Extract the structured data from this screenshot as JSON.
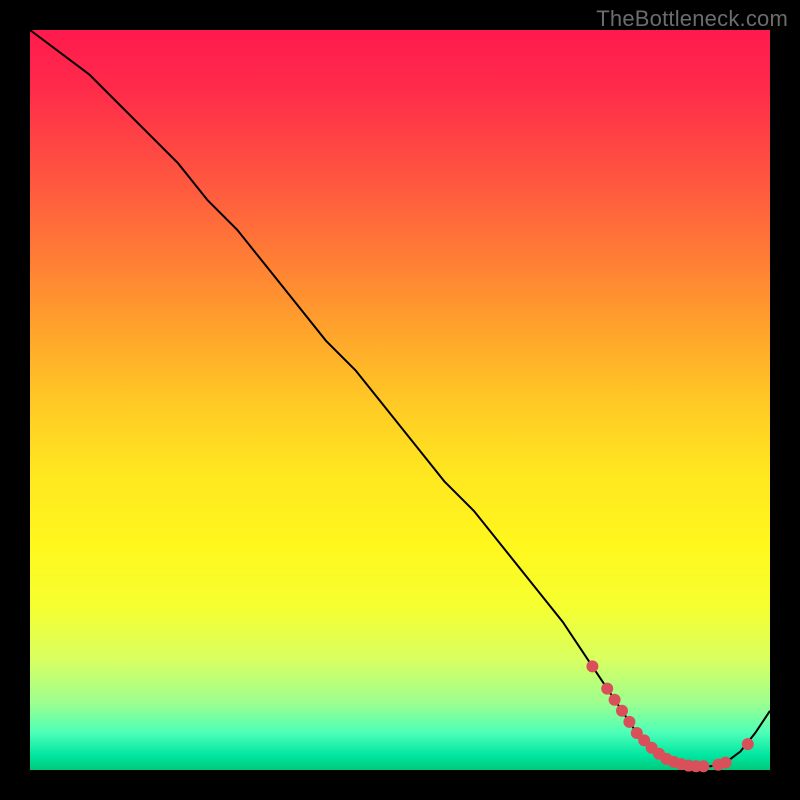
{
  "watermark": "TheBottleneck.com",
  "colors": {
    "background": "#000000",
    "marker": "#d9505a",
    "curve": "#000000",
    "watermark_text": "#6c6c6c"
  },
  "chart_data": {
    "type": "line",
    "title": "",
    "xlabel": "",
    "ylabel": "",
    "xlim": [
      0,
      100
    ],
    "ylim": [
      0,
      100
    ],
    "series": [
      {
        "name": "bottleneck-curve",
        "x": [
          0,
          4,
          8,
          12,
          16,
          20,
          24,
          28,
          32,
          36,
          40,
          44,
          48,
          52,
          56,
          60,
          64,
          68,
          72,
          74,
          76,
          78,
          80,
          82,
          84,
          86,
          88,
          90,
          92,
          94,
          96,
          98,
          100
        ],
        "y": [
          100,
          97,
          94,
          90,
          86,
          82,
          77,
          73,
          68,
          63,
          58,
          54,
          49,
          44,
          39,
          35,
          30,
          25,
          20,
          17,
          14,
          11,
          8,
          5,
          3,
          1.5,
          0.8,
          0.5,
          0.5,
          1,
          2.5,
          5,
          8
        ]
      }
    ],
    "markers": {
      "name": "highlighted-points",
      "x": [
        76,
        78,
        79,
        80,
        81,
        82,
        83,
        84,
        85,
        86,
        87,
        88,
        89,
        90,
        91,
        93,
        94,
        97
      ],
      "y": [
        14,
        11,
        9.5,
        8,
        6.5,
        5,
        4,
        3,
        2.2,
        1.5,
        1.1,
        0.8,
        0.6,
        0.5,
        0.5,
        0.7,
        1,
        3.5
      ]
    }
  }
}
